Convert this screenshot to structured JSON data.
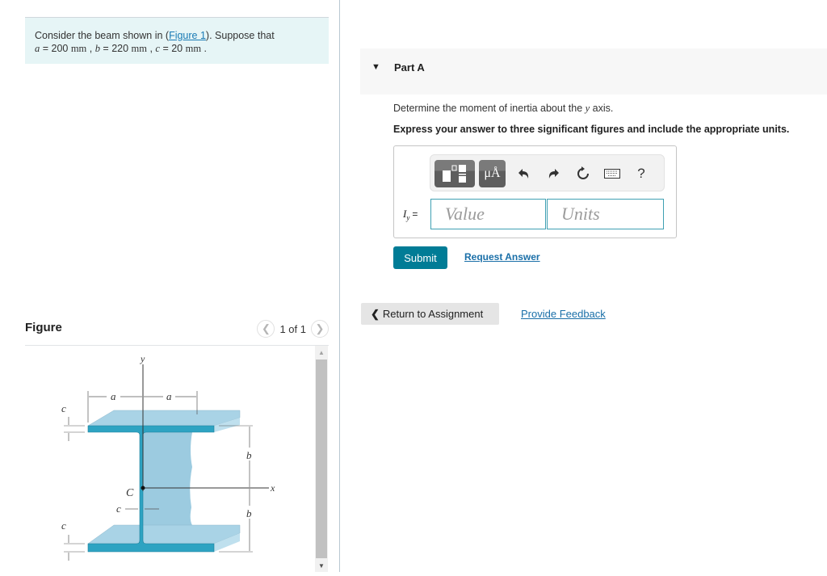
{
  "problem": {
    "intro_prefix": "Consider the beam shown in (",
    "figure_link": "Figure 1",
    "intro_suffix": "). Suppose that",
    "values": [
      {
        "var": "a",
        "eq": " = 200 ",
        "unit": "mm",
        "sep": " , "
      },
      {
        "var": "b",
        "eq": " = 220 ",
        "unit": "mm",
        "sep": " , "
      },
      {
        "var": "c",
        "eq": " = 20 ",
        "unit": "mm",
        "sep": " ."
      }
    ]
  },
  "figure": {
    "title": "Figure",
    "pager": {
      "prev_icon": "chevron-left-icon",
      "count": "1 of 1",
      "next_icon": "chevron-right-icon"
    },
    "labels": {
      "y_axis": "y",
      "x_axis": "x",
      "centroid": "C",
      "a": "a",
      "b": "b",
      "c": "c"
    },
    "colors": {
      "flange_front": "#2ea3c2",
      "flange_top": "#a9d3e6",
      "web": "#9ccbe0",
      "line": "#333333"
    }
  },
  "part": {
    "caret_icon": "caret-down-icon",
    "title": "Part A",
    "question_prefix": "Determine the moment of inertia about the ",
    "question_var": "y",
    "question_suffix": " axis.",
    "instruction": "Express your answer to three significant figures and include the appropriate units."
  },
  "answer": {
    "toolbar": {
      "templates_icon": "templates-icon",
      "units_label": "μÅ",
      "undo_icon": "undo-icon",
      "redo_icon": "redo-icon",
      "reset_icon": "reset-icon",
      "keyboard_icon": "keyboard-icon",
      "help_label": "?"
    },
    "label_var": "I",
    "label_sub": "y",
    "label_eq": "=",
    "value_placeholder": "Value",
    "units_placeholder": "Units"
  },
  "actions": {
    "submit": "Submit",
    "request_answer": "Request Answer",
    "return": "Return to Assignment",
    "feedback": "Provide Feedback"
  },
  "colors": {
    "accent": "#007c96",
    "link": "#1a6fa8",
    "intro_bg": "#e6f5f6",
    "input_border": "#3fa0b3"
  }
}
